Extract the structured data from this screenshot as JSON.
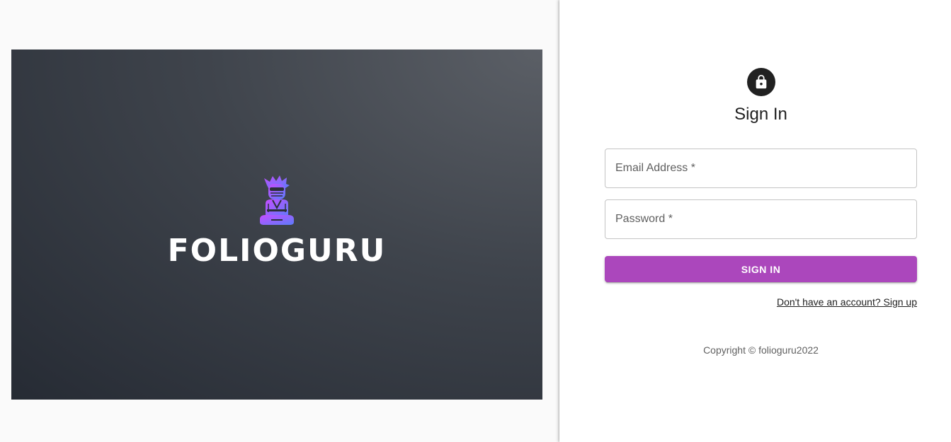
{
  "brand": {
    "name": "FOLIOGURU"
  },
  "signin": {
    "title": "Sign In",
    "email_label": "Email Address *",
    "password_label": "Password *",
    "submit_label": "SIGN IN",
    "signup_link": "Don't have an account? Sign up",
    "copyright": "Copyright © folioguru2022"
  },
  "icons": {
    "lock": "lock-icon",
    "mascot": "ninja-mascot-icon"
  },
  "colors": {
    "accent": "#ab47bc",
    "avatar": "#212121",
    "hero_dark": "#262b34",
    "hero_light": "#5b5f66",
    "mascot_gradient_start": "#c44dff",
    "mascot_gradient_end": "#5c7cfa"
  }
}
